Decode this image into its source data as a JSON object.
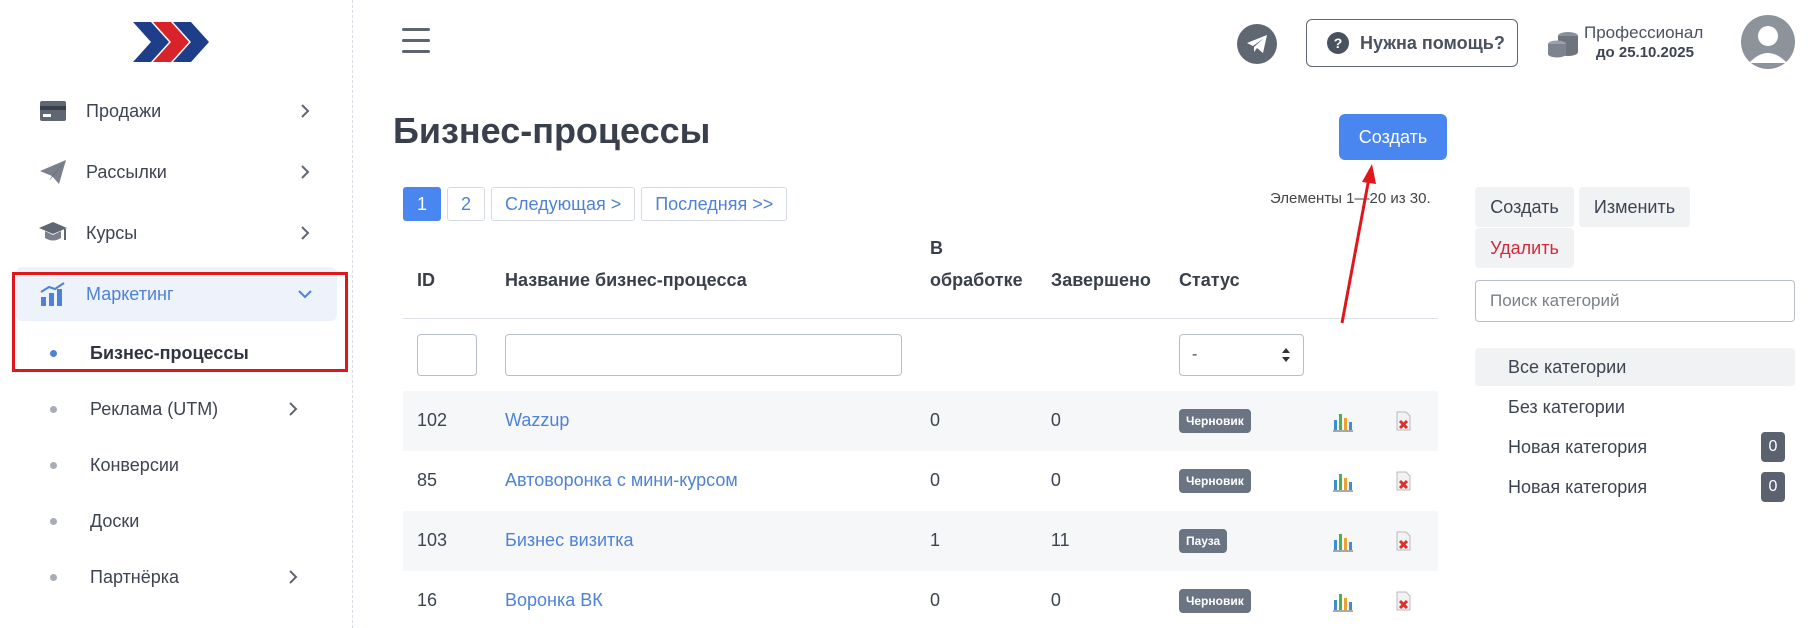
{
  "sidebar": {
    "items": [
      {
        "label": "Продажи",
        "icon": "credit-card-icon"
      },
      {
        "label": "Рассылки",
        "icon": "paper-plane-icon"
      },
      {
        "label": "Курсы",
        "icon": "graduation-cap-icon"
      },
      {
        "label": "Маркетинг",
        "icon": "chart-growth-icon"
      }
    ],
    "sub_items": [
      {
        "label": "Бизнес-процессы"
      },
      {
        "label": "Реклама (UTM)"
      },
      {
        "label": "Конверсии"
      },
      {
        "label": "Доски"
      },
      {
        "label": "Партнёрка"
      }
    ]
  },
  "header": {
    "help_label": "Нужна помощь?",
    "help_icon_char": "?",
    "plan_name": "Профессионал",
    "plan_date": "до 25.10.2025"
  },
  "main": {
    "title": "Бизнес-процессы",
    "create_label": "Создать",
    "pager": [
      "1",
      "2",
      "Следующая >",
      "Последняя >>"
    ],
    "elements_count": "Элементы 1—20 из 30.",
    "columns": {
      "id": "ID",
      "name": "Название бизнес-процесса",
      "processing_1": "В",
      "processing_2": "обработке",
      "done": "Завершено",
      "status": "Статус"
    },
    "status_filter": "-",
    "rows": [
      {
        "id": "102",
        "name": "Wazzup",
        "processing": "0",
        "done": "0",
        "status": "Черновик"
      },
      {
        "id": "85",
        "name": "Автоворонка с мини-курсом",
        "processing": "0",
        "done": "0",
        "status": "Черновик"
      },
      {
        "id": "103",
        "name": "Бизнес визитка",
        "processing": "1",
        "done": "11",
        "status": "Пауза"
      },
      {
        "id": "16",
        "name": "Воронка ВК",
        "processing": "0",
        "done": "0",
        "status": "Черновик"
      }
    ]
  },
  "categories": {
    "create_label": "Создать",
    "edit_label": "Изменить",
    "delete_label": "Удалить",
    "search_placeholder": "Поиск категорий",
    "items": [
      {
        "label": "Все категории",
        "count": ""
      },
      {
        "label": "Без категории",
        "count": ""
      },
      {
        "label": "Новая категория",
        "count": "0"
      },
      {
        "label": "Новая категория",
        "count": "0"
      }
    ]
  },
  "colors": {
    "accent": "#4a86f0",
    "highlight": "#e0161a",
    "badge": "#6b7483"
  }
}
